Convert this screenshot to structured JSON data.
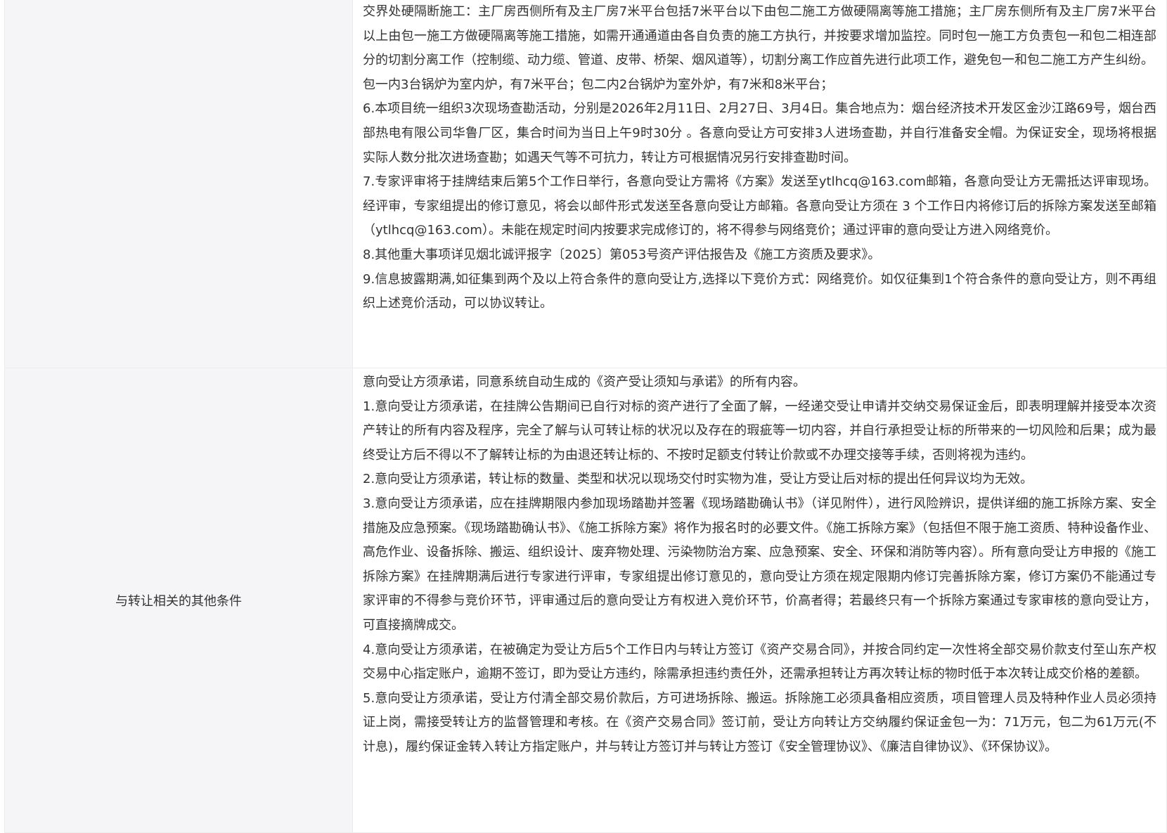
{
  "rows": [
    {
      "label": "",
      "paragraphs": [
        "交界处硬隔断施工：主厂房西侧所有及主厂房7米平台包括7米平台以下由包二施工方做硬隔离等施工措施；主厂房东侧所有及主厂房7米平台以上由包一施工方做硬隔离等施工措施，如需开通通道由各自负责的施工方执行，并按要求增加监控。同时包一施工方负责包一和包二相连部分的切割分离工作（控制缆、动力缆、管道、皮带、桥架、烟风道等），切割分离工作应首先进行此项工作，避免包一和包二施工方产生纠纷。",
        "包一内3台锅炉为室内炉，有7米平台；包二内2台锅炉为室外炉，有7米和8米平台；",
        "6.本项目统一组织3次现场查勘活动，分别是2026年2月11日、2月27日、3月4日。集合地点为：烟台经济技术开发区金沙江路69号，烟台西部热电有限公司华鲁厂区，集合时间为当日上午9时30分 。各意向受让方可安排3人进场查勘，并自行准备安全帽。为保证安全，现场将根据实际人数分批次进场查勘；如遇天气等不可抗力，转让方可根据情况另行安排查勘时间。",
        "7.专家评审将于挂牌结束后第5个工作日举行，各意向受让方需将《方案》发送至ytlhcq@163.com邮箱，各意向受让方无需抵达评审现场。经评审，专家组提出的修订意见，将会以邮件形式发送至各意向受让方邮箱。各意向受让方须在 3 个工作日内将修订后的拆除方案发送至邮箱（ytlhcq@163.com）。未能在规定时间内按要求完成修订的，将不得参与网络竞价；通过评审的意向受让方进入网络竞价。",
        "8.其他重大事项详见烟北诚评报字〔2025〕第053号资产评估报告及《施工方资质及要求》。",
        "9.信息披露期满,如征集到两个及以上符合条件的意向受让方,选择以下竞价方式：网络竞价。如仅征集到1个符合条件的意向受让方，则不再组织上述竞价活动，可以协议转让。"
      ]
    },
    {
      "label": "与转让相关的其他条件",
      "paragraphs": [
        "意向受让方须承诺，同意系统自动生成的《资产受让须知与承诺》的所有内容。",
        "1.意向受让方须承诺，在挂牌公告期间已自行对标的资产进行了全面了解，一经递交受让申请并交纳交易保证金后，即表明理解并接受本次资产转让的所有内容及程序，完全了解与认可转让标的状况以及存在的瑕疵等一切内容，并自行承担受让标的所带来的一切风险和后果；成为最终受让方后不得以不了解转让标的为由退还转让标的、不按时足额支付转让价款或不办理交接等手续，否则将视为违约。",
        "2.意向受让方须承诺，转让标的数量、类型和状况以现场交付时实物为准，受让方受让后对标的提出任何异议均为无效。",
        "3.意向受让方须承诺，应在挂牌期限内参加现场踏勘并签署《现场踏勘确认书》（详见附件），进行风险辨识，提供详细的施工拆除方案、安全措施及应急预案。《现场踏勘确认书》、《施工拆除方案》将作为报名时的必要文件。《施工拆除方案》（包括但不限于施工资质、特种设备作业、高危作业、设备拆除、搬运、组织设计、废弃物处理、污染物防治方案、应急预案、安全、环保和消防等内容）。所有意向受让方申报的《施工拆除方案》在挂牌期满后进行专家进行评审，专家组提出修订意见的，意向受让方须在规定限期内修订完善拆除方案，修订方案仍不能通过专家评审的不得参与竞价环节，评审通过后的意向受让方有权进入竞价环节，价高者得；若最终只有一个拆除方案通过专家审核的意向受让方，可直接摘牌成交。",
        "4.意向受让方须承诺，在被确定为受让方后5个工作日内与转让方签订《资产交易合同》，并按合同约定一次性将全部交易价款支付至山东产权交易中心指定账户，逾期不签订，即为受让方违约，除需承担违约责任外，还需承担转让方再次转让标的物时低于本次转让成交价格的差额。",
        "5.意向受让方须承诺，受让方付清全部交易价款后，方可进场拆除、搬运。拆除施工必须具备相应资质，项目管理人员及特种作业人员必须持证上岗，需接受转让方的监督管理和考核。在《资产交易合同》签订前，受让方向转让方交纳履约保证金包一为：71万元，包二为61万元(不计息)，履约保证金转入转让方指定账户，并与转让方签订并与转让方签订《安全管理协议》、《廉洁自律协议》、《环保协议》。"
      ]
    }
  ]
}
